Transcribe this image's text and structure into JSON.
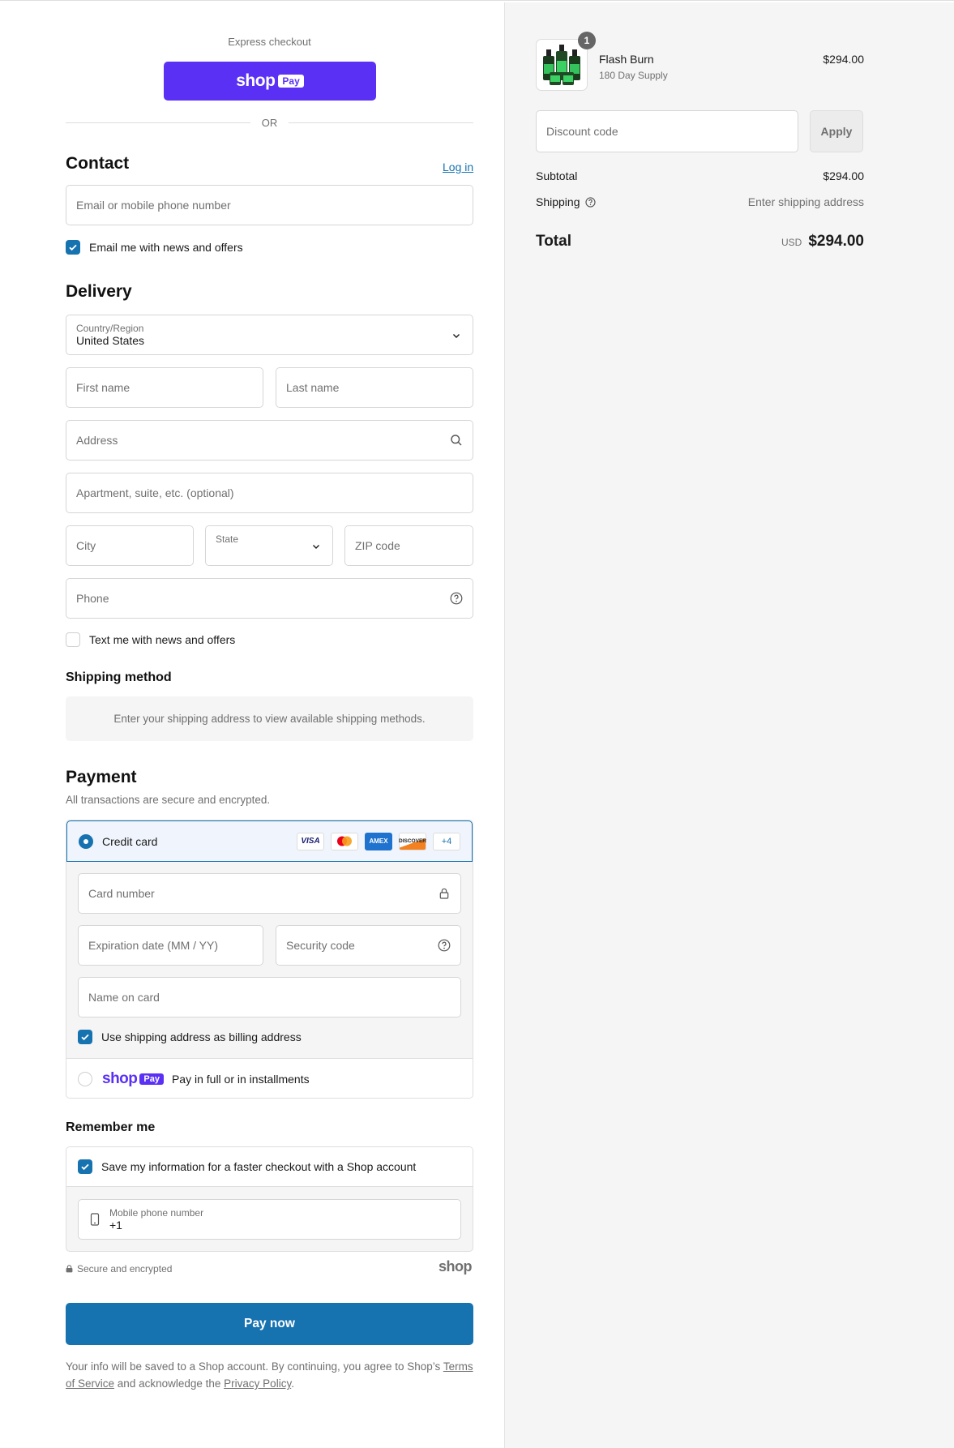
{
  "express": {
    "label": "Express checkout",
    "shop_pay_word": "shop",
    "shop_pay_badge": "Pay",
    "or_label": "OR"
  },
  "contact": {
    "title": "Contact",
    "login_link": "Log in",
    "email_placeholder": "Email or mobile phone number",
    "email_news_label": "Email me with news and offers",
    "email_news_checked": true
  },
  "delivery": {
    "title": "Delivery",
    "country_label": "Country/Region",
    "country_value": "United States",
    "first_name_placeholder": "First name",
    "last_name_placeholder": "Last name",
    "address_placeholder": "Address",
    "apartment_placeholder": "Apartment, suite, etc. (optional)",
    "city_placeholder": "City",
    "state_label": "State",
    "zip_placeholder": "ZIP code",
    "phone_placeholder": "Phone",
    "text_news_label": "Text me with news and offers",
    "text_news_checked": false
  },
  "shipping_method": {
    "title": "Shipping method",
    "message": "Enter your shipping address to view available shipping methods."
  },
  "payment": {
    "title": "Payment",
    "subtitle": "All transactions are secure and encrypted.",
    "credit_card_label": "Credit card",
    "card_brands": [
      "VISA",
      "Mastercard",
      "AMEX",
      "DISCOVER"
    ],
    "more_brands": "+4",
    "card_number_placeholder": "Card number",
    "expiration_placeholder": "Expiration date (MM / YY)",
    "security_code_placeholder": "Security code",
    "name_on_card_placeholder": "Name on card",
    "billing_same_label": "Use shipping address as billing address",
    "billing_same_checked": true,
    "shop_pay_word": "shop",
    "shop_pay_badge": "Pay",
    "shop_pay_option_label": "Pay in full or in installments"
  },
  "remember": {
    "title": "Remember me",
    "save_info_label": "Save my information for a faster checkout with a Shop account",
    "save_info_checked": true,
    "mobile_label": "Mobile phone number",
    "mobile_value": "+1",
    "secure_label": "Secure and encrypted",
    "shop_logo": "shop"
  },
  "pay_button": "Pay now",
  "legal": {
    "text_before": "Your info will be saved to a Shop account. By continuing, you agree to Shop’s",
    "terms_link": "Terms of Service",
    "text_middle": "and acknowledge the",
    "privacy_link": "Privacy Policy",
    "text_end": "."
  },
  "summary": {
    "product_name": "Flash Burn",
    "product_variant": "180 Day Supply",
    "product_qty": "1",
    "product_price": "$294.00",
    "discount_placeholder": "Discount code",
    "apply_label": "Apply",
    "subtotal_label": "Subtotal",
    "subtotal_value": "$294.00",
    "shipping_label": "Shipping",
    "shipping_value": "Enter shipping address",
    "total_label": "Total",
    "currency": "USD",
    "total_value": "$294.00"
  },
  "colors": {
    "shop_purple": "#5a31f4",
    "primary_blue": "#1773b0",
    "summary_bg": "#f5f5f5"
  }
}
